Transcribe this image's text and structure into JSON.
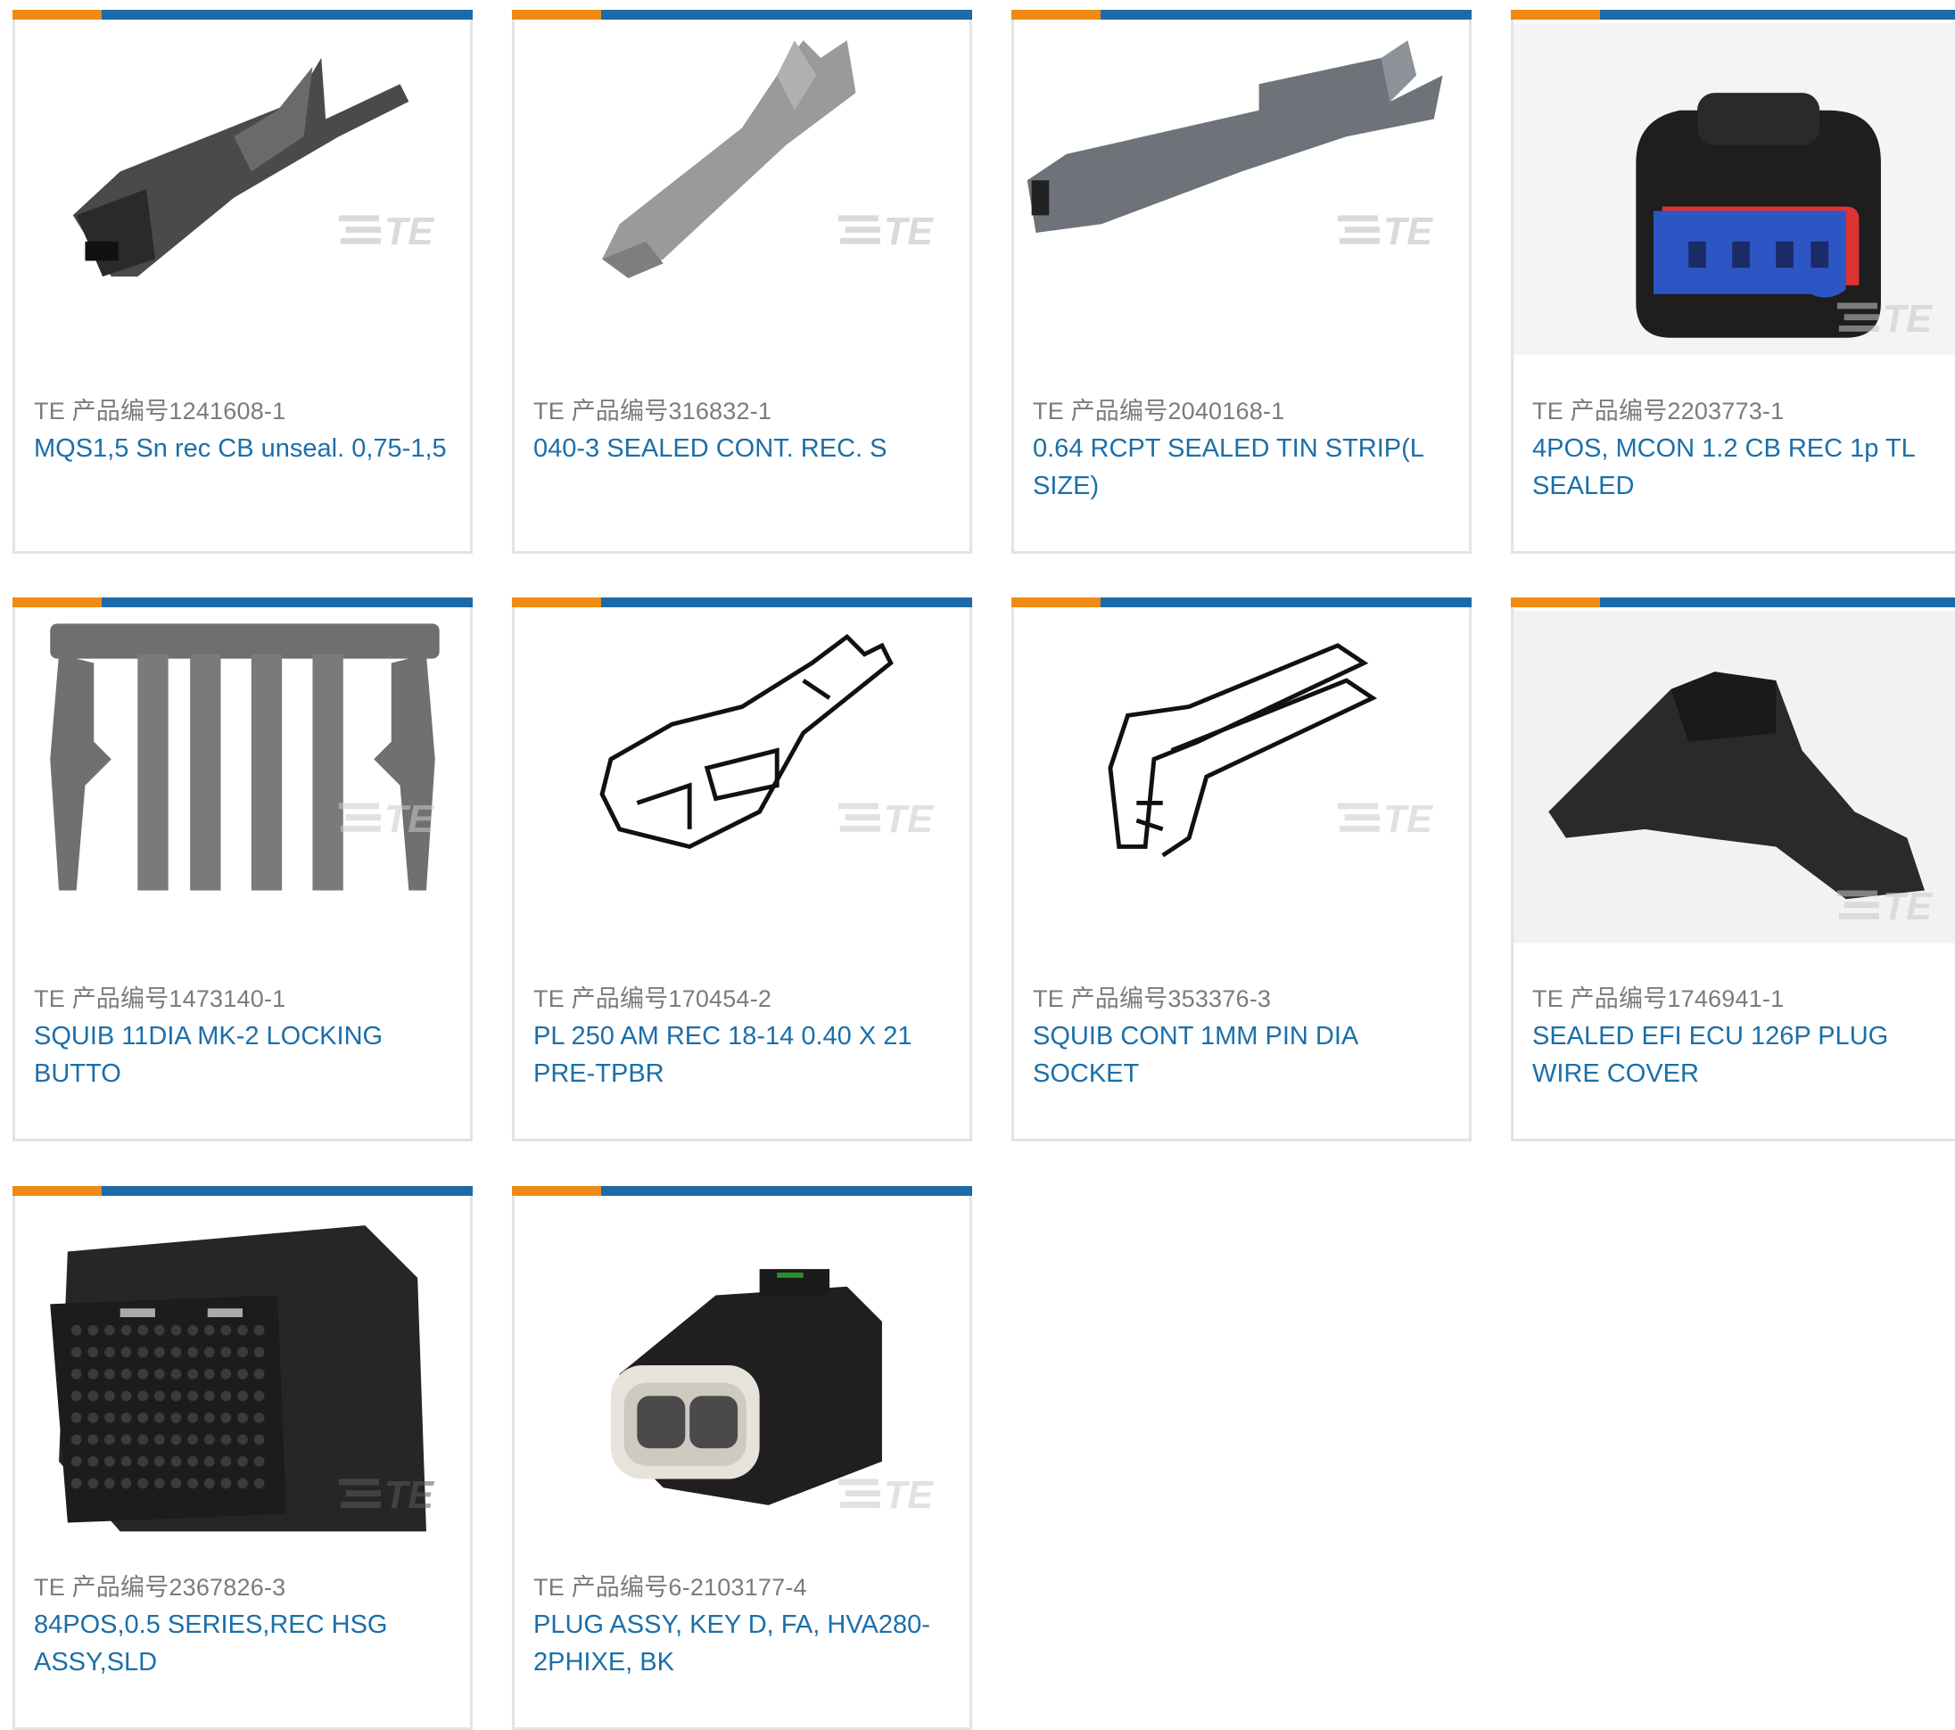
{
  "colors": {
    "accent_orange": "#ef8a14",
    "accent_blue": "#1c6aa8",
    "link": "#1b6fa8",
    "meta_gray": "#7b7b7b",
    "card_border": "#e3e3e3"
  },
  "part_prefix": "TE 产品编号",
  "watermark": "TE",
  "products": [
    {
      "part_no": "1241608-1",
      "desc": "MQS1,5 Sn rec CB unseal. 0,75-1,5",
      "image": "terminal-dark-icon"
    },
    {
      "part_no": "316832-1",
      "desc": "040-3 SEALED CONT. REC. S",
      "image": "terminal-gray-icon"
    },
    {
      "part_no": "2040168-1",
      "desc": "0.64 RCPT SEALED TIN STRIP(L SIZE)",
      "image": "terminal-long-icon"
    },
    {
      "part_no": "2203773-1",
      "desc": "4POS, MCON 1.2 CB REC 1p TL SEALED",
      "image": "connector-blue-icon"
    },
    {
      "part_no": "1473140-1",
      "desc": "SQUIB 11DIA MK-2 LOCKING BUTTO",
      "image": "locking-button-icon"
    },
    {
      "part_no": "170454-2",
      "desc": "PL 250 AM REC 18-14 0.40 X 21 PRE-TPBR",
      "image": "receptacle-sketch-icon"
    },
    {
      "part_no": "353376-3",
      "desc": "SQUIB CONT 1MM PIN DIA SOCKET",
      "image": "socket-sketch-icon"
    },
    {
      "part_no": "1746941-1",
      "desc": "SEALED EFI ECU 126P PLUG WIRE COVER",
      "image": "wire-cover-icon"
    },
    {
      "part_no": "2367826-3",
      "desc": "84POS,0.5 SERIES,REC HSG ASSY,SLD",
      "image": "housing-84pos-icon"
    },
    {
      "part_no": "6-2103177-4",
      "desc": "PLUG ASSY, KEY D, FA, HVA280-2PHIXE, BK",
      "image": "plug-2pos-icon"
    }
  ]
}
